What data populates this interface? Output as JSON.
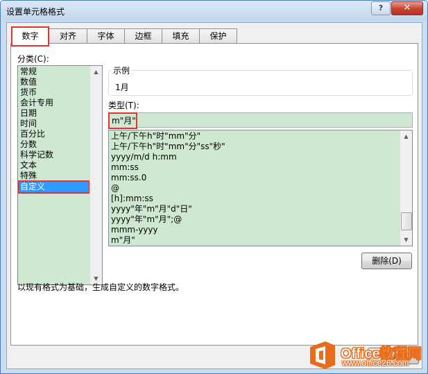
{
  "window": {
    "title": "设置单元格格式",
    "help_label": "?",
    "close_label": "✕"
  },
  "tabs": [
    {
      "label": "数字",
      "active": true
    },
    {
      "label": "对齐",
      "active": false
    },
    {
      "label": "字体",
      "active": false
    },
    {
      "label": "边框",
      "active": false
    },
    {
      "label": "填充",
      "active": false
    },
    {
      "label": "保护",
      "active": false
    }
  ],
  "category": {
    "label": "分类(C):",
    "items": [
      "常规",
      "数值",
      "货币",
      "会计专用",
      "日期",
      "时间",
      "百分比",
      "分数",
      "科学记数",
      "文本",
      "特殊",
      "自定义"
    ],
    "selected": "自定义"
  },
  "sample": {
    "label": "示例",
    "value": "1月"
  },
  "type": {
    "label": "类型(T):",
    "value": "m\"月\"",
    "items": [
      "上午/下午h\"时\"mm\"分\"",
      "上午/下午h\"时\"mm\"分\"ss\"秒\"",
      "yyyy/m/d h:mm",
      "mm:ss",
      "mm:ss.0",
      "@",
      "[h]:mm:ss",
      "yyyy\"年\"m\"月\"d\"日\"",
      "yyyy\"年\"m\"月\";@",
      "mmm-yyyy",
      "m\"月\""
    ]
  },
  "delete_button": "删除(D)",
  "description": "以现有格式为基础，生成自定义的数字格式。",
  "footer": {
    "cancel_label": "取消"
  },
  "watermark": {
    "brand": "Office教程网",
    "url": "www.office26.com"
  },
  "colors": {
    "accent_red": "#e63228",
    "list_bg": "#cfe8d2",
    "selection": "#3399ff",
    "watermark_orange": "#e86c1a"
  }
}
